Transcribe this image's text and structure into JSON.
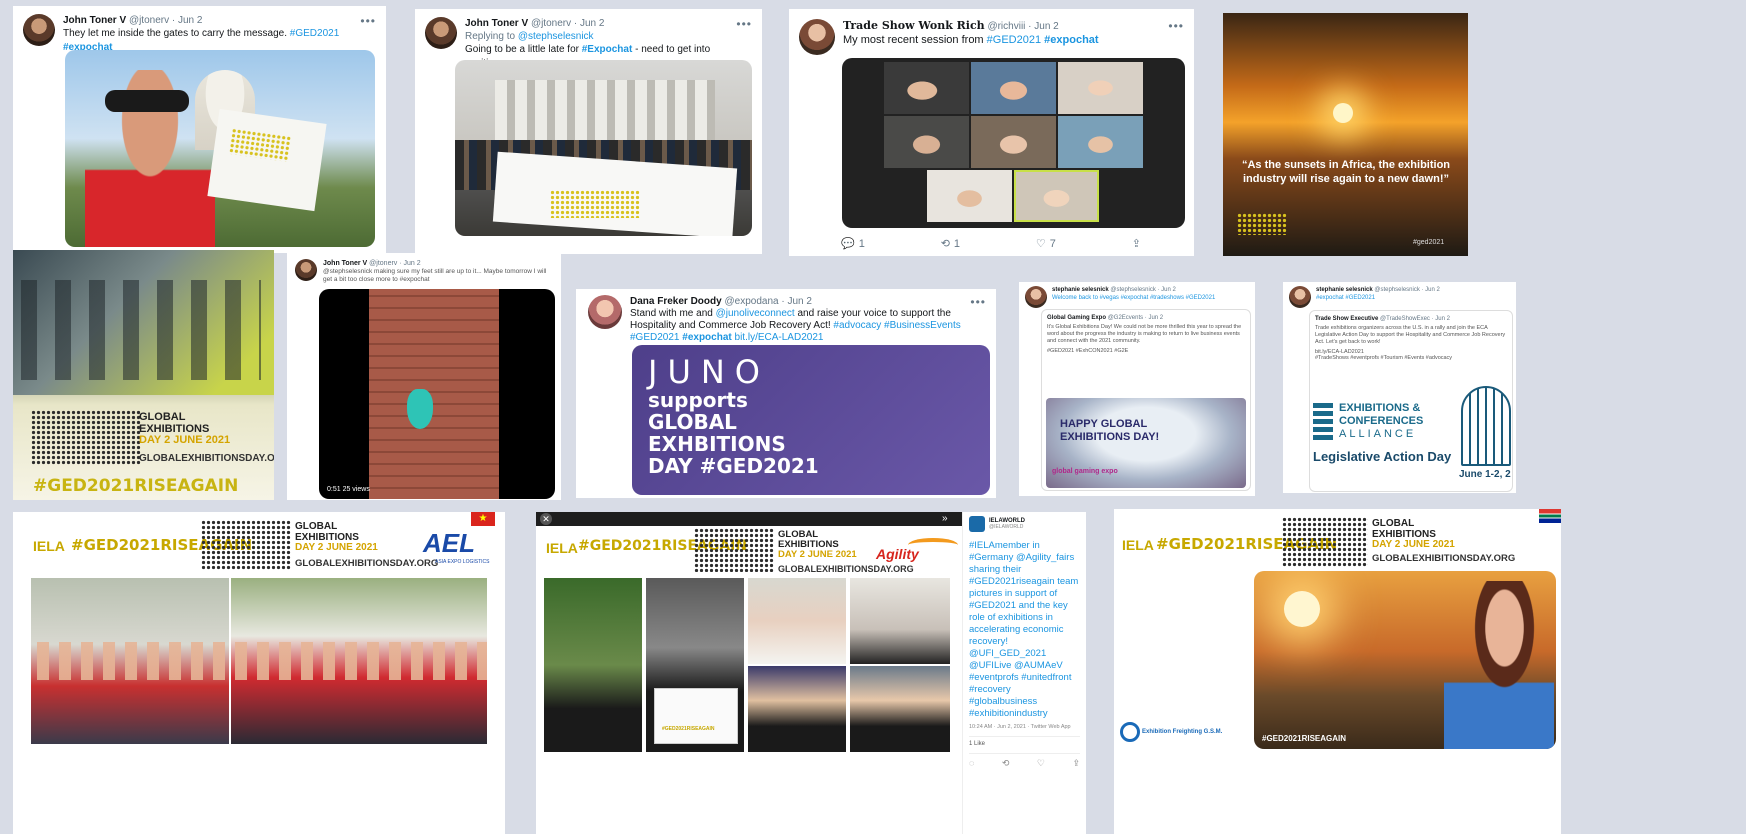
{
  "tweet1": {
    "name": "John Toner V",
    "handle": "@jtonerv",
    "date": "· Jun 2",
    "text_plain": "They let me inside the gates to carry the message. ",
    "tag1": "#GED2021",
    "tag2": "#expochat"
  },
  "tweet2": {
    "name": "John Toner V",
    "handle": "@jtonerv",
    "date": "· Jun 2",
    "replying_label": "Replying to ",
    "replying_to": "@stephselesnick",
    "text_plain": "Going to be a little late for ",
    "tag": "#Expochat",
    "text_after": " - need to get into position."
  },
  "tweet3": {
    "name": "Trade Show Wonk Rich",
    "handle": "@richviii",
    "date": "· Jun 2",
    "text_plain": "My most recent session from ",
    "tag1": "#GED2021",
    "tag2": "#expochat",
    "reply_count": "1",
    "retweet_count": "1",
    "like_count": "7"
  },
  "sunset_card": {
    "quote": "“As the sunsets in Africa, the exhibition industry will rise again to a new dawn!”",
    "hashtag": "#ged2021"
  },
  "ged_card": {
    "title_line1": "GLOBAL",
    "title_line2": "EXHIBITIONS",
    "title_line3": "DAY 2 JUNE 2021",
    "url": "GLOBALEXHIBITIONSDAY.ORG",
    "hashtag": "#GED2021RISEAGAIN"
  },
  "tweet5": {
    "name": "John Toner V",
    "handle": "@jtonerv",
    "date": "· Jun 2",
    "text": "@stephselesnick making sure my feet still are up to it... Maybe tomorrow I will get a bit too close more to #expochat",
    "video_time": "0:51",
    "video_views": "25 views"
  },
  "tweet6": {
    "name": "Dana Freker Doody",
    "handle": "@expodana",
    "date": "· Jun 2",
    "text1": "Stand with me and ",
    "mention": "@junoliveconnect",
    "text2": " and raise your voice to support the Hospitality and Commerce Job Recovery Act! ",
    "tags1": "#advocacy #BusinessEvents",
    "tags2": "#GED2021",
    "tag_bold": "#expochat",
    "link": "bit.ly/ECA-LAD2021",
    "banner_line1": "JUNO",
    "banner_line2": "supports",
    "banner_line3": "GLOBAL",
    "banner_line4": "EXHBITIONS",
    "banner_line5": "DAY #GED2021"
  },
  "tweet7": {
    "name": "stephanie selesnick",
    "handle": "@stephselesnick",
    "date": "· Jun 2",
    "text": "Welcome back to #vegas #expochat #tradeshows #GED2021",
    "quoted_name": "Global Gaming Expo",
    "quoted_handle": "@G2Ecvents · Jun 2",
    "quoted_text": "It's Global Exhibitions Day! We could not be more thrilled this year to spread the word about the progress the industry is making to return to live business events and connect with the 2021 community.",
    "quoted_tags": "#GED2021 #ExhCON2021 #G2E",
    "banner_line1": "HAPPY GLOBAL",
    "banner_line2": "EXHIBITIONS DAY!",
    "logo": "global gaming expo"
  },
  "tweet8": {
    "name": "stephanie selesnick",
    "handle": "@stephselesnick",
    "date": "· Jun 2",
    "text": "#expochat #GED2021",
    "quoted_name": "Trade Show Executive",
    "quoted_handle": "@TradeShowExec · Jun 2",
    "quoted_text": "Trade exhibitions organizers across the U.S. in a rally and join the ECA Legislative Action Day to support the Hospitality and Commerce Job Recovery Act. Let's get back to work!",
    "quoted_link": "bit.ly/ECA-LAD2021",
    "quoted_tags": "#TradeShows #eventprofs #Tourism #Events #advocacy",
    "eca_line1": "EXHIBITIONS &",
    "eca_line2": "CONFERENCES",
    "eca_line3": "ALLIANCE",
    "eca_event": "Legislative Action Day",
    "eca_dates": "June 1-2, 2"
  },
  "aei_card": {
    "iela": "IELA",
    "hashtag": "#GED2021RISEAGAIN",
    "title_line1": "GLOBAL",
    "title_line2": "EXHIBITIONS",
    "title_line3": "DAY 2 JUNE 2021",
    "url": "GLOBALEXHIBITIONSDAY.ORG",
    "logo": "AEL",
    "logo_sub": "ASIA EXPO LOGISTICS"
  },
  "agility_card": {
    "iela": "IELA",
    "hashtag": "#GED2021RISEAGAIN",
    "title_line1": "GLOBAL",
    "title_line2": "EXHIBITIONS",
    "title_line3": "DAY 2 JUNE 2021",
    "url": "GLOBALEXHIBITIONSDAY.ORG",
    "logo": "Agility",
    "sign_tag": "#GED2021RISEAGAIN"
  },
  "iela_tweet": {
    "name": "IELAWORLD",
    "handle": "@IELAWORLD",
    "text": "#IELAmember in #Germany @Agility_fairs sharing their #GED2021riseagain team pictures in support of #GED2021 and the key role of exhibitions in accelerating economic recovery! @UFI_GED_2021 @UFILive @AUMAeV #eventprofs #unitedfront #recovery #globalbusiness #exhibitionindustry",
    "timestamp": "10:24 AM · Jun 2, 2021 · Twitter Web App",
    "likes": "1 Like"
  },
  "egs_card": {
    "iela": "IELA",
    "hashtag": "#GED2021RISEAGAIN",
    "title_line1": "GLOBAL",
    "title_line2": "EXHIBITIONS",
    "title_line3": "DAY 2 JUNE 2021",
    "url": "GLOBALEXHIBITIONSDAY.ORG",
    "logo": "Exhibition Freighting G.S.M.",
    "photo_tag": "#GED2021RISEAGAIN"
  }
}
